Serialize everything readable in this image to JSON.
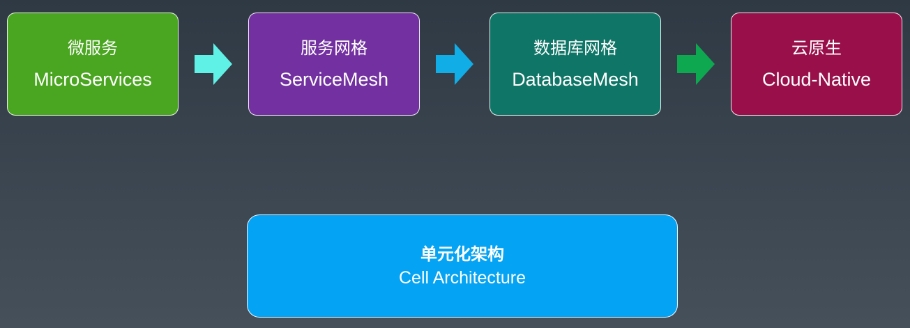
{
  "colors": {
    "micro": "#4aa520",
    "servicemesh": "#7230a0",
    "databasemesh": "#0f7566",
    "cloud": "#980f4a",
    "arrow1": "#5ff0e6",
    "arrow2": "#11ade6",
    "arrow3": "#0ea850",
    "cell": "#04a3f3"
  },
  "stages": [
    {
      "cn": "微服务",
      "en": "MicroServices"
    },
    {
      "cn": "服务网格",
      "en": "ServiceMesh"
    },
    {
      "cn": "数据库网格",
      "en": "DatabaseMesh"
    },
    {
      "cn": "云原生",
      "en": "Cloud-Native"
    }
  ],
  "cell": {
    "cn": "单元化架构",
    "en": "Cell Architecture"
  },
  "icons": [
    "right-arrow-icon"
  ]
}
